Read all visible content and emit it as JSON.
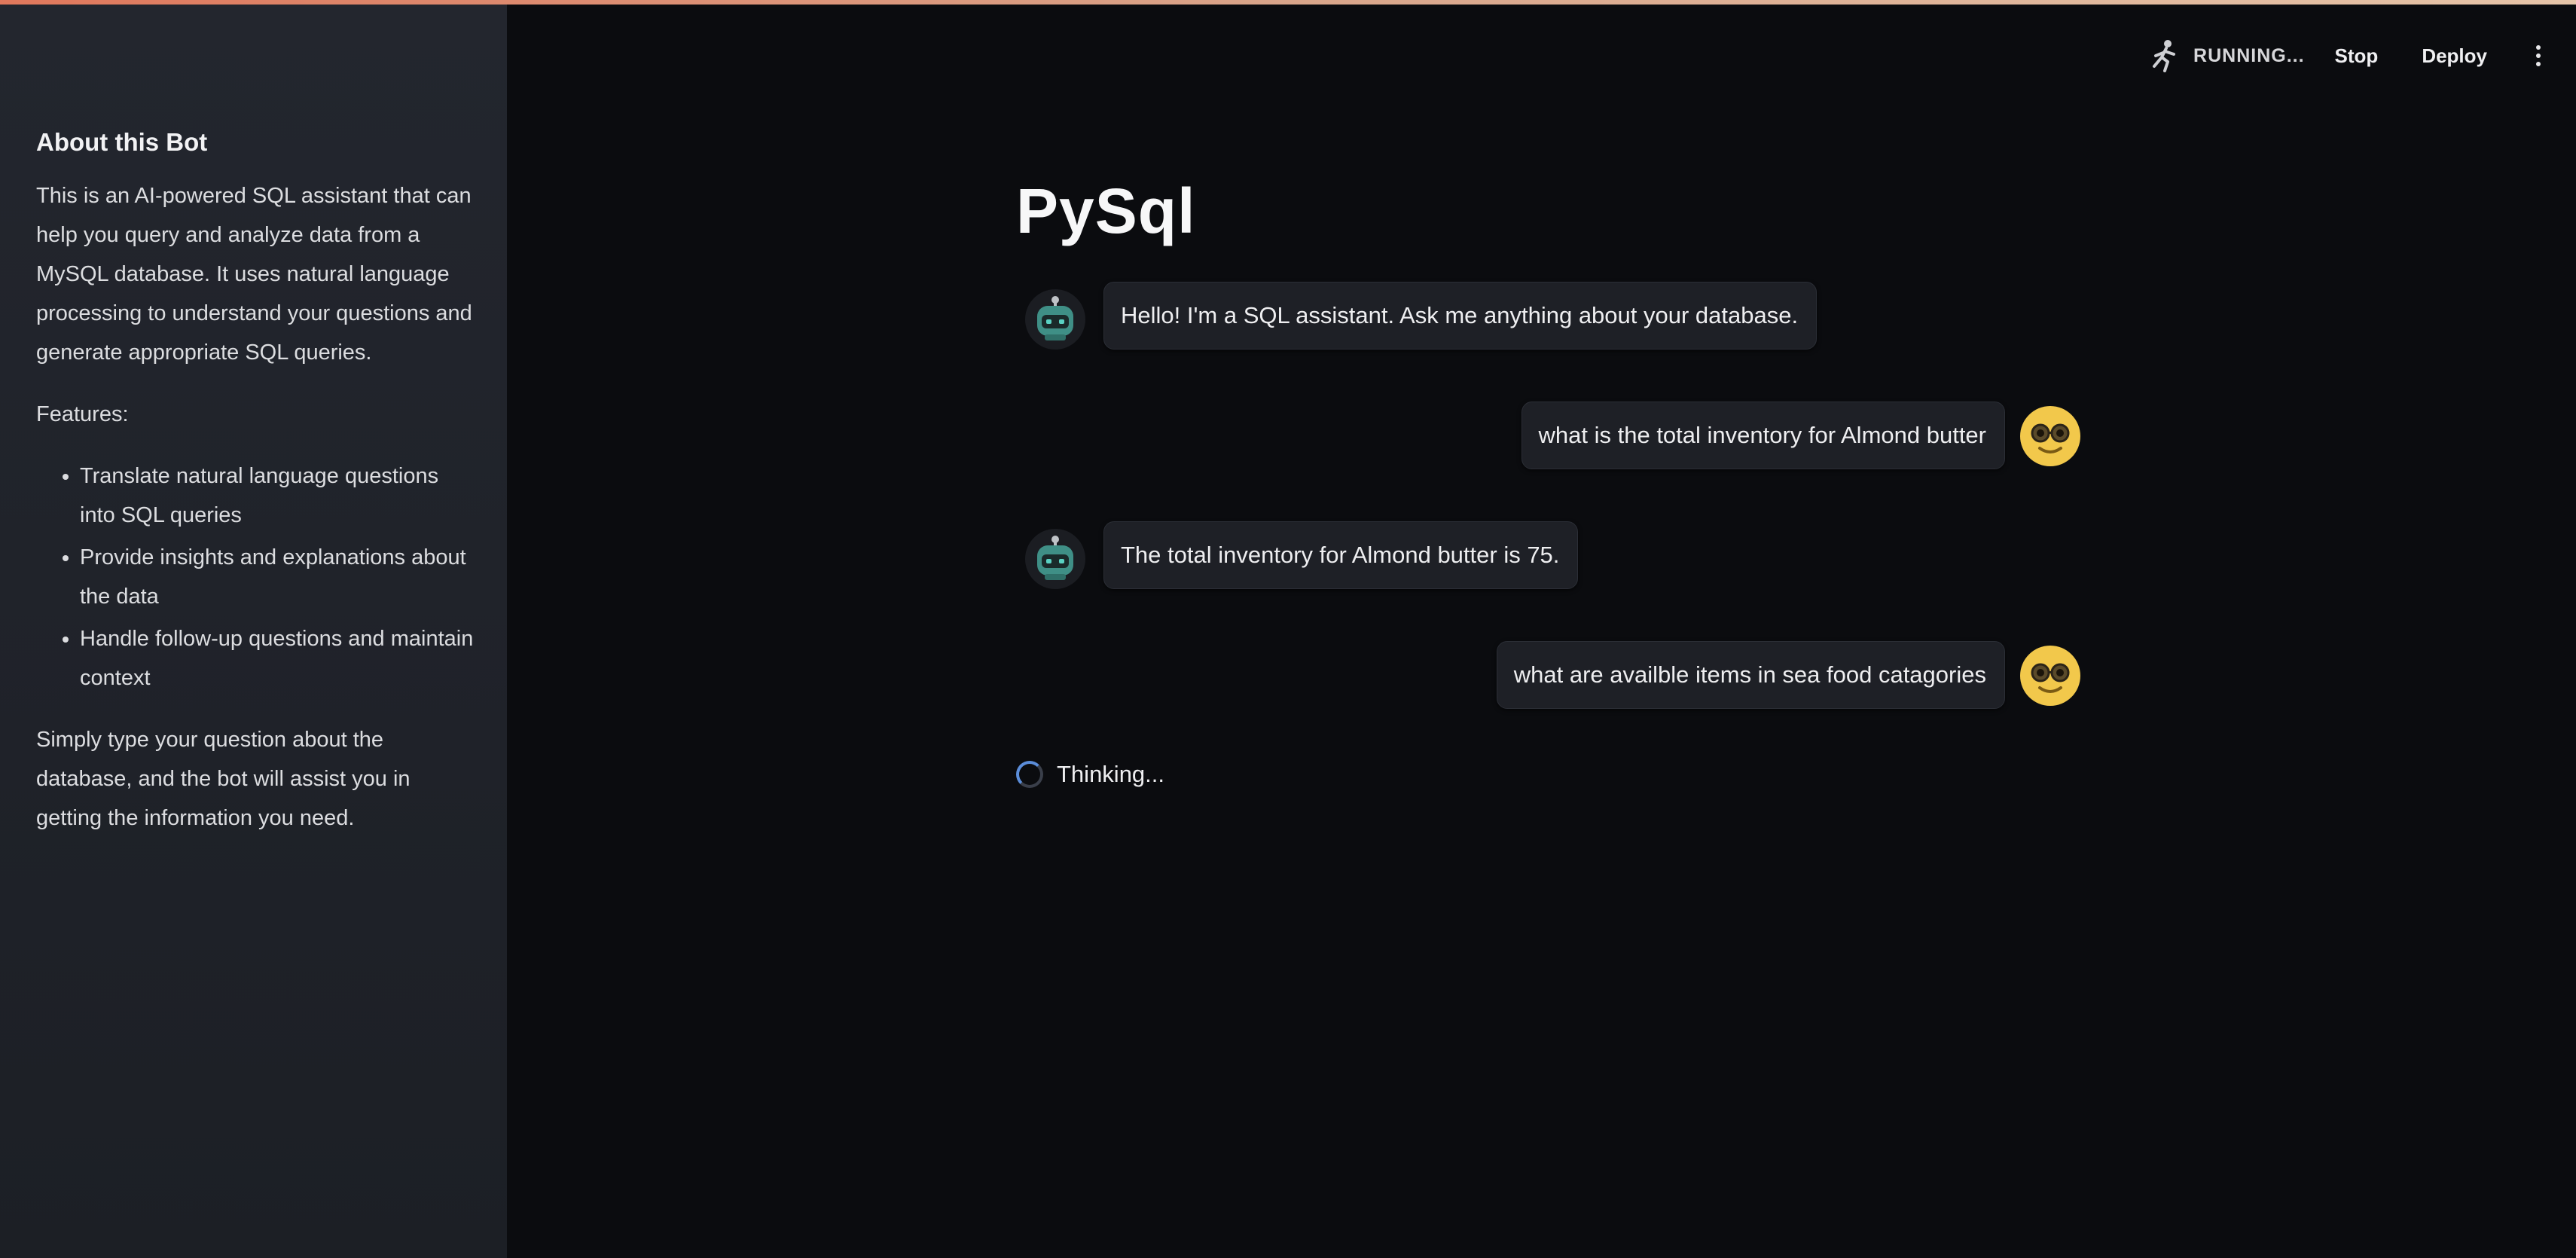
{
  "sidebar": {
    "heading": "About this Bot",
    "intro": "This is an AI-powered SQL assistant that can help you query and analyze data from a MySQL database. It uses natural language processing to understand your questions and generate appropriate SQL queries.",
    "features_label": "Features:",
    "features": [
      "Translate natural language questions into SQL queries",
      "Provide insights and explanations about the data",
      "Handle follow-up questions and maintain context"
    ],
    "outro": "Simply type your question about the database, and the bot will assist you in getting the information you need."
  },
  "header": {
    "status_label": "RUNNING...",
    "status_icon": "running-man-icon",
    "stop_label": "Stop",
    "deploy_label": "Deploy",
    "menu_icon": "kebab-menu-icon"
  },
  "main": {
    "title": "PySql",
    "messages": [
      {
        "role": "assistant",
        "text": "Hello! I'm a SQL assistant. Ask me anything about your database."
      },
      {
        "role": "user",
        "text": "what is the total inventory for Almond butter"
      },
      {
        "role": "assistant",
        "text": "The total inventory for Almond butter is 75."
      },
      {
        "role": "user",
        "text": "what are availble items in sea food catagories"
      }
    ],
    "thinking_label": "Thinking..."
  },
  "colors": {
    "background": "#0b0c0f",
    "sidebar": "#22252c",
    "bubble": "#1e2026",
    "spinner_accent": "#5b8dd9",
    "bot_avatar": "#3f8f86",
    "user_avatar": "#f2c84b"
  }
}
